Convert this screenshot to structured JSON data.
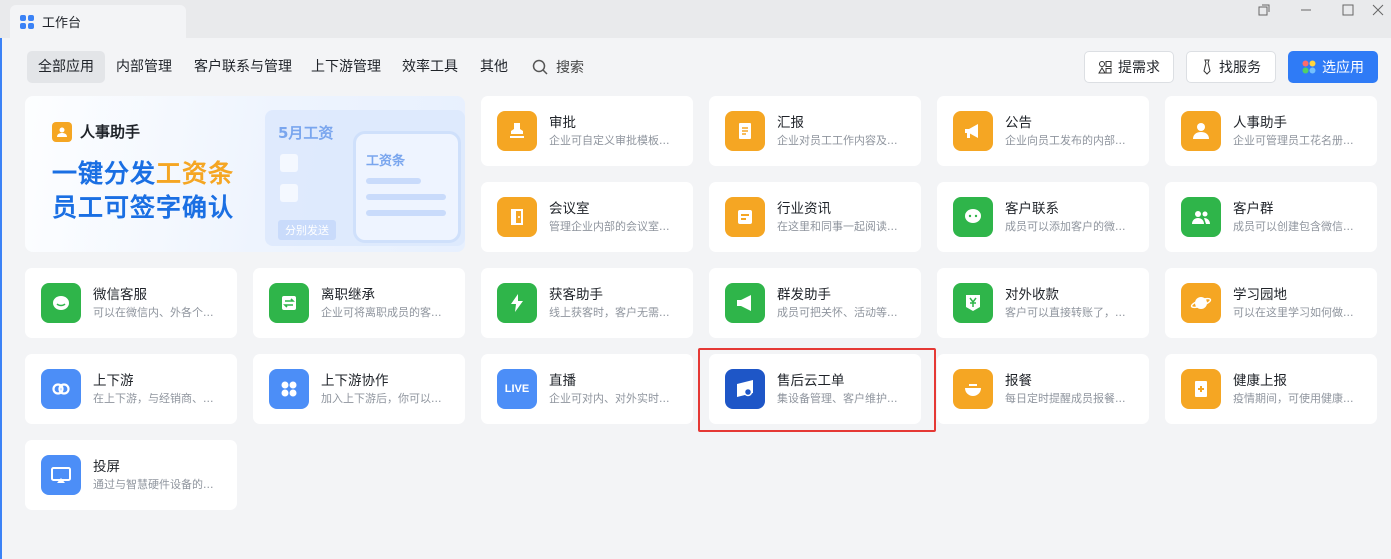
{
  "window": {
    "tab_title": "工作台"
  },
  "nav": {
    "tabs": [
      {
        "label": "全部应用",
        "active": true
      },
      {
        "label": "内部管理"
      },
      {
        "label": "客户联系与管理"
      },
      {
        "label": "上下游管理"
      },
      {
        "label": "效率工具"
      },
      {
        "label": "其他"
      }
    ],
    "search_label": "搜索"
  },
  "header_buttons": {
    "request": "提需求",
    "service": "找服务",
    "select_app": "选应用"
  },
  "banner": {
    "badge": "人事助手",
    "line1_prefix": "一键分发",
    "line1_highlight": "工资条",
    "line2": "员工可签字确认",
    "mock_title": "5月工资",
    "mock_sub": "工资条",
    "mock_button": "分别发送"
  },
  "apps": [
    {
      "name": "审批",
      "desc": "企业可自定义审批模板...",
      "icon": "stamp-icon",
      "color": "#f5a623"
    },
    {
      "name": "汇报",
      "desc": "企业对员工工作内容及...",
      "icon": "report-icon",
      "color": "#f5a623"
    },
    {
      "name": "公告",
      "desc": "企业向员工发布的内部...",
      "icon": "megaphone-icon",
      "color": "#f5a623"
    },
    {
      "name": "人事助手",
      "desc": "企业可管理员工花名册...",
      "icon": "person-icon",
      "color": "#f5a623"
    },
    {
      "name": "会议室",
      "desc": "管理企业内部的会议室...",
      "icon": "door-icon",
      "color": "#f5a623"
    },
    {
      "name": "行业资讯",
      "desc": "在这里和同事一起阅读...",
      "icon": "news-icon",
      "color": "#f5a623"
    },
    {
      "name": "客户联系",
      "desc": "成员可以添加客户的微...",
      "icon": "chat-icon",
      "color": "#2fb54a"
    },
    {
      "name": "客户群",
      "desc": "成员可以创建包含微信...",
      "icon": "group-icon",
      "color": "#2fb54a"
    },
    {
      "name": "微信客服",
      "desc": "可以在微信内、外各个...",
      "icon": "wechat-service-icon",
      "color": "#2fb54a"
    },
    {
      "name": "离职继承",
      "desc": "企业可将离职成员的客...",
      "icon": "transfer-icon",
      "color": "#2fb54a"
    },
    {
      "name": "获客助手",
      "desc": "线上获客时，客户无需...",
      "icon": "lightning-icon",
      "color": "#2fb54a"
    },
    {
      "name": "群发助手",
      "desc": "成员可把关怀、活动等...",
      "icon": "broadcast-icon",
      "color": "#2fb54a"
    },
    {
      "name": "对外收款",
      "desc": "客户可以直接转账了，...",
      "icon": "payment-icon",
      "color": "#2fb54a"
    },
    {
      "name": "学习园地",
      "desc": "可以在这里学习如何做...",
      "icon": "planet-icon",
      "color": "#f5a623"
    },
    {
      "name": "上下游",
      "desc": "在上下游，与经销商、...",
      "icon": "link-icon",
      "color": "#4c8ef7"
    },
    {
      "name": "上下游协作",
      "desc": "加入上下游后，你可以...",
      "icon": "grid-icon",
      "color": "#4c8ef7"
    },
    {
      "name": "直播",
      "desc": "企业可对内、对外实时...",
      "icon": "live-icon",
      "color": "#4c8ef7",
      "icon_text": "LIVE"
    },
    {
      "name": "售后云工单",
      "desc": "集设备管理、客户维护...",
      "icon": "aftersales-icon",
      "color": "#1e56c7"
    },
    {
      "name": "报餐",
      "desc": "每日定时提醒成员报餐...",
      "icon": "bowl-icon",
      "color": "#f5a623"
    },
    {
      "name": "健康上报",
      "desc": "疫情期间，可使用健康...",
      "icon": "health-icon",
      "color": "#f5a623"
    },
    {
      "name": "投屏",
      "desc": "通过与智慧硬件设备的...",
      "icon": "screen-cast-icon",
      "color": "#4c8ef7"
    }
  ]
}
